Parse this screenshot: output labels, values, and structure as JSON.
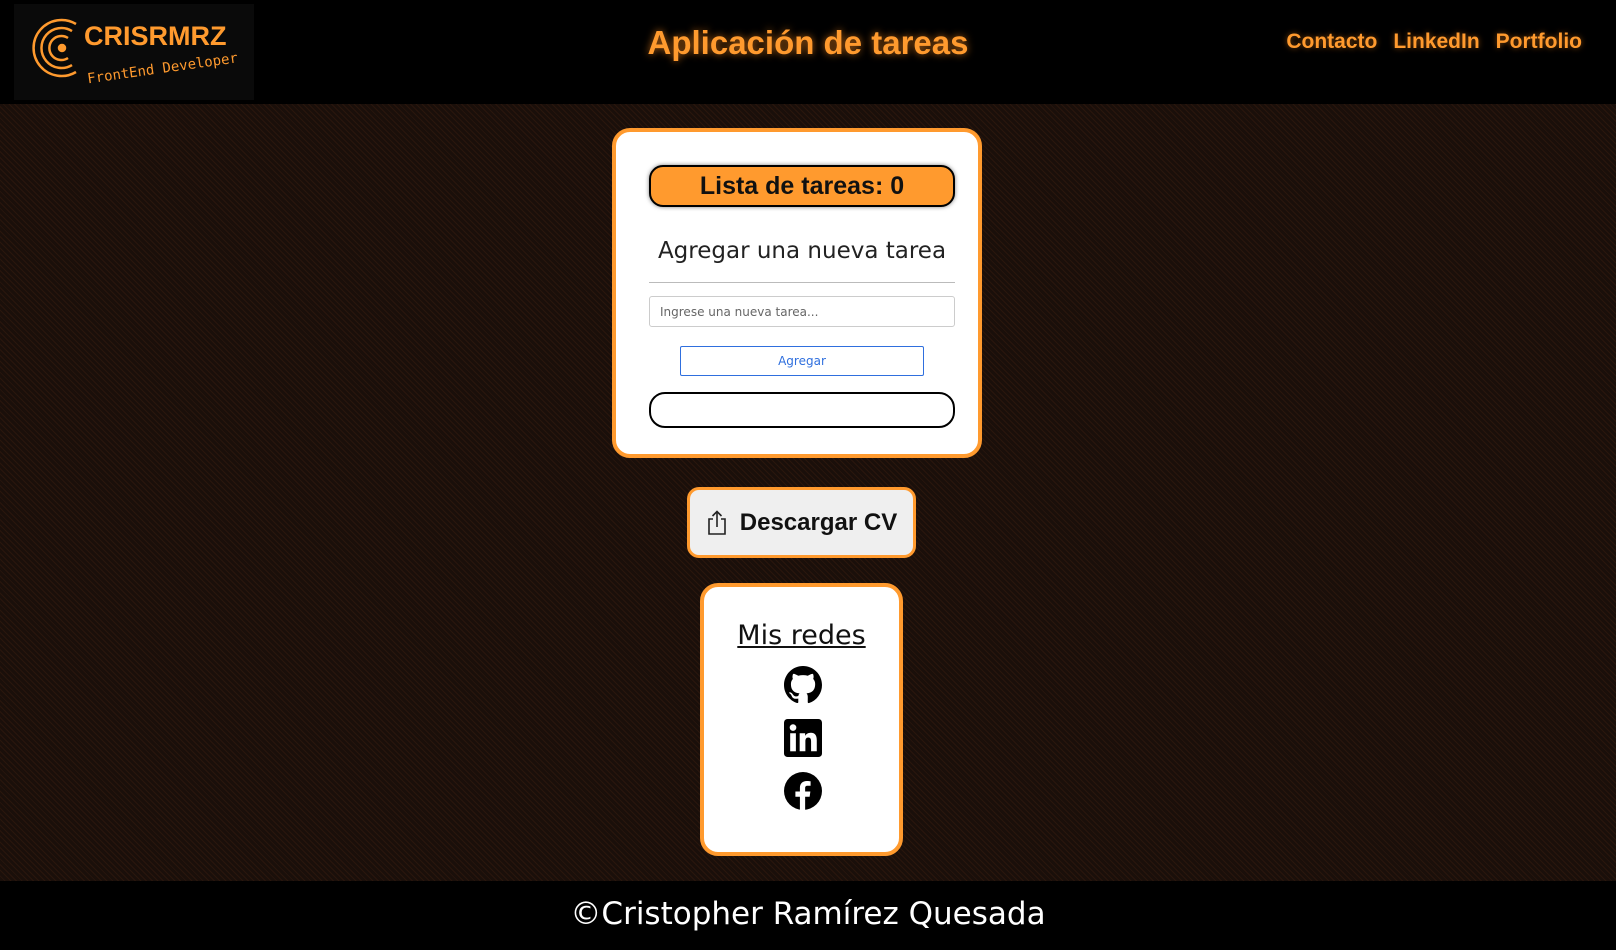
{
  "header": {
    "logo": {
      "name": "CRISRMRZ",
      "tagline": "FrontEnd Developer"
    },
    "title": "Aplicación de tareas",
    "nav": [
      {
        "label": "Contacto"
      },
      {
        "label": "LinkedIn"
      },
      {
        "label": "Portfolio"
      }
    ]
  },
  "todo": {
    "count_label": "Lista de tareas: 0",
    "heading": "Agregar una nueva tarea",
    "input_placeholder": "Ingrese una nueva tarea...",
    "input_value": "",
    "add_button_label": "Agregar"
  },
  "cv": {
    "button_label": "Descargar CV",
    "icon": "share-icon"
  },
  "social": {
    "title": "Mis redes",
    "links": [
      {
        "icon": "github-icon"
      },
      {
        "icon": "linkedin-icon"
      },
      {
        "icon": "facebook-icon"
      }
    ]
  },
  "footer": {
    "text": "©Cristopher Ramírez Quesada"
  },
  "colors": {
    "accent": "#ff9a2e",
    "header_bg": "#000000",
    "card_bg": "#ffffff",
    "link_button": "#2f6fde"
  }
}
